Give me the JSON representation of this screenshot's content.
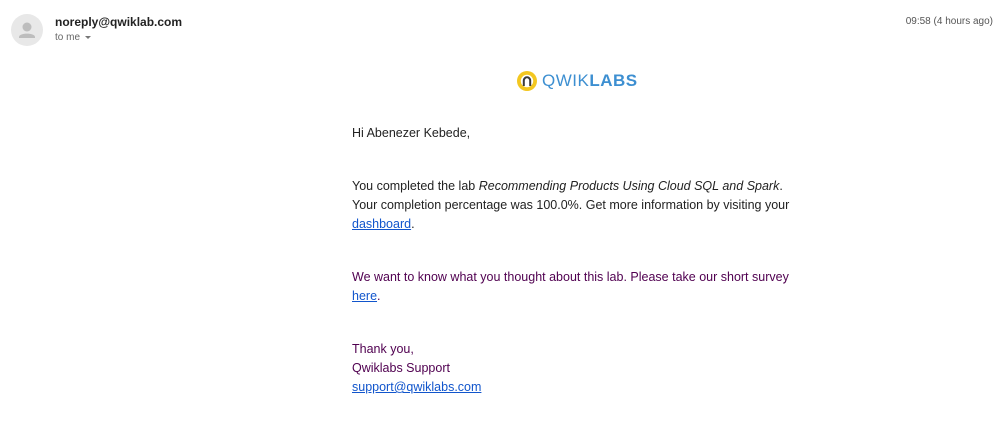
{
  "header": {
    "sender": "noreply@qwiklab.com",
    "recipient_label": "to me",
    "timestamp": "09:58 (4 hours ago)"
  },
  "logo": {
    "text_light": "QWIK",
    "text_bold": "LABS",
    "colors": {
      "icon_yellow": "#f3c720",
      "text_blue": "#3d8fd1"
    }
  },
  "body": {
    "greeting": "Hi Abenezer Kebede,",
    "completed_prefix": "You completed the lab ",
    "lab_name": "Recommending Products Using Cloud SQL and Spark",
    "completed_suffix": ".",
    "percentage_text": "Your completion percentage was 100.0%. Get more information by visiting your ",
    "dashboard_link": "dashboard",
    "after_dashboard": ".",
    "survey_text": "We want to know what you thought about this lab. Please take our short survey ",
    "survey_link": "here",
    "after_survey": ".",
    "thanks": "Thank you,",
    "team": "Qwiklabs Support",
    "support_email": "support@qwiklabs.com"
  }
}
